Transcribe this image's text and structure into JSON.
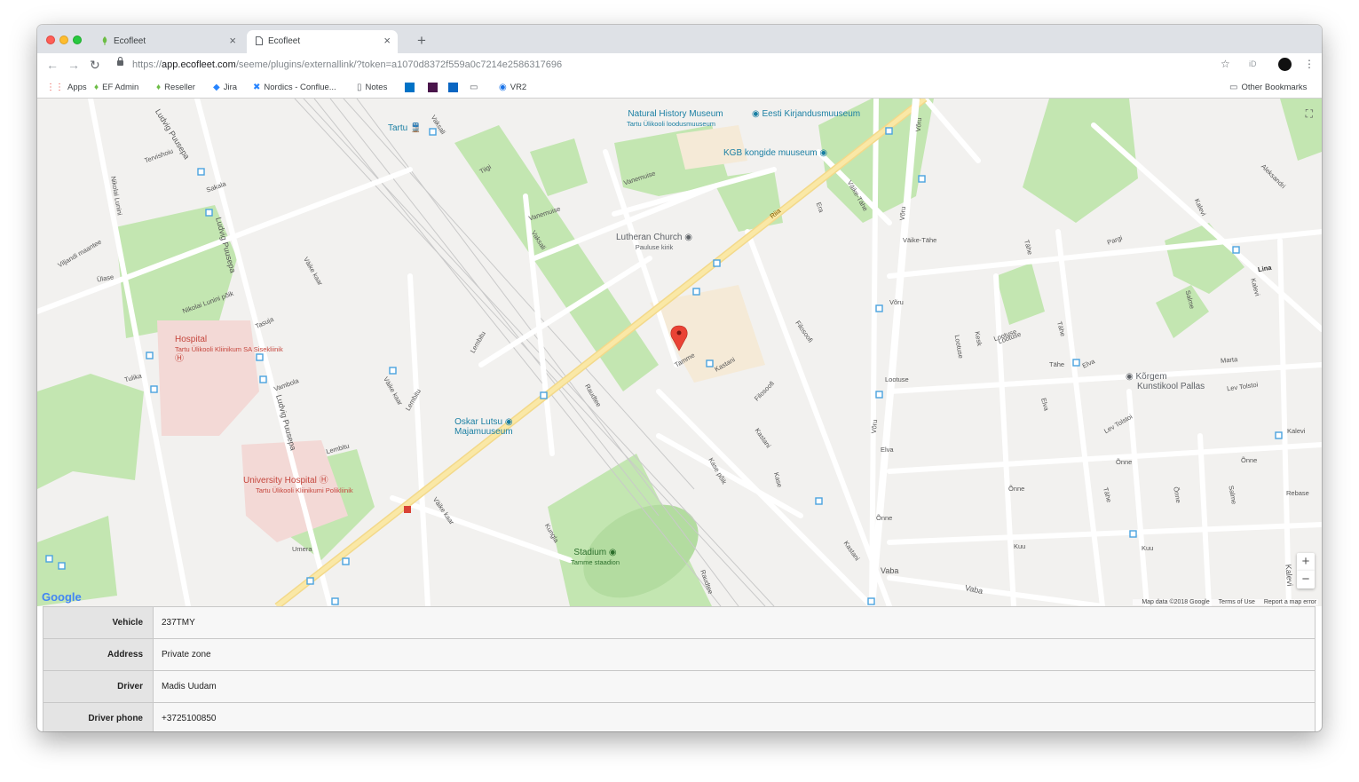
{
  "browser": {
    "tabs": [
      {
        "title": "Ecofleet",
        "active": false,
        "icon": "ecofleet-leaf-icon"
      },
      {
        "title": "Ecofleet",
        "active": true,
        "icon": "page-icon"
      }
    ],
    "url": {
      "scheme": "https://",
      "host": "app.ecofleet.com",
      "path": "/seeme/plugins/externallink/?token=a1070d8372f559a0c7214e2586317696"
    },
    "profile_label": "iD",
    "bookmarks": [
      {
        "label": "Apps",
        "icon": "apps-grid-icon"
      },
      {
        "label": "EF Admin",
        "icon": "ecofleet-leaf-icon"
      },
      {
        "label": "Reseller",
        "icon": "ecofleet-leaf-icon"
      },
      {
        "label": "Jira",
        "icon": "jira-icon"
      },
      {
        "label": "Nordics - Conflue...",
        "icon": "confluence-icon"
      },
      {
        "label": "Notes",
        "icon": "page-icon"
      },
      {
        "label": "VR2",
        "icon": "vr2-icon"
      }
    ],
    "other_bookmarks": "Other Bookmarks"
  },
  "map": {
    "pois": [
      {
        "name": "Tartu",
        "sub": ""
      },
      {
        "name": "Natural History Museum",
        "sub": "Tartu Ülikooli loodusmuuseum"
      },
      {
        "name": "Eesti Kirjandusmuuseum",
        "sub": ""
      },
      {
        "name": "KGB kongide muuseum",
        "sub": ""
      },
      {
        "name": "Lutheran Church",
        "sub": "Pauluse kirik"
      },
      {
        "name": "Hospital",
        "sub": "Tartu Ülikooli Kliinikum SA Sisekliinik"
      },
      {
        "name": "Oskar Lutsu",
        "sub": "Majamuuseum"
      },
      {
        "name": "University Hospital",
        "sub": "Tartu Ülikooli Kliinikumi Polikliinik"
      },
      {
        "name": "Stadium",
        "sub": "Tamme staadion"
      },
      {
        "name": "Kõrgem",
        "sub": "Kunstikool Pallas"
      }
    ],
    "streets": [
      "Riia",
      "Vaksali",
      "Ludvig Puusepa",
      "Võru",
      "Väike-Tähe",
      "Filosoofi",
      "Kastani",
      "Tamme",
      "Vanemuise",
      "Lembitu",
      "Pargi",
      "Kalevi",
      "Tähe",
      "Lootuse",
      "Elva",
      "Õnne",
      "Kuu",
      "Vaba",
      "Vaba",
      "Lina",
      "Salme",
      "Marta",
      "Lev Tolstoi",
      "Väike kaar",
      "Kesk",
      "Era",
      "Aleksandri",
      "Sakala",
      "Tiigi",
      "Kroonuaia",
      "Rebase",
      "Lootuse",
      "Kase",
      "Kase põik",
      "Raudtee",
      "Kungla",
      "Liiva",
      "Nikolai Lunini",
      "Vanemuise",
      "Tasuja",
      "Vambola",
      "Umera",
      "Tulika",
      "Nikolai Lunini põik",
      "Tervishoiu",
      "Ülase",
      "Viljandi maantee",
      "Kalevi",
      "Tähe",
      "Kuu",
      "Õnne",
      "Kaunase"
    ],
    "google_label": "Google",
    "attribution": {
      "data": "Map data ©2018 Google",
      "terms": "Terms of Use",
      "report": "Report a map error"
    },
    "zoom_in": "+",
    "zoom_out": "−",
    "fullscreen": "⛶"
  },
  "info_table": [
    {
      "label": "Vehicle",
      "value": "237TMY"
    },
    {
      "label": "Address",
      "value": "Private zone"
    },
    {
      "label": "Driver",
      "value": "Madis Uudam"
    },
    {
      "label": "Driver phone",
      "value": "+3725100850"
    }
  ]
}
